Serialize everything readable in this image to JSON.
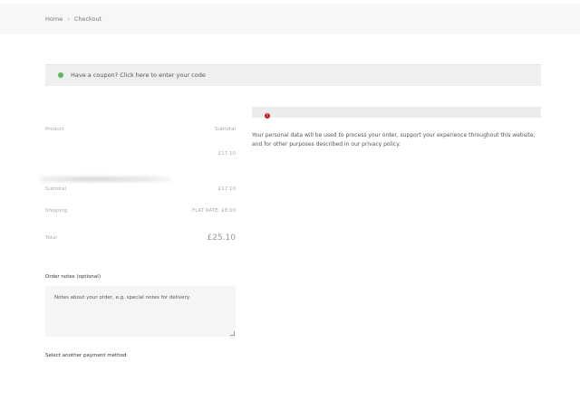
{
  "breadcrumb": {
    "home": "Home",
    "separator": "›",
    "current": "Checkout"
  },
  "coupon": {
    "text": "Have a coupon? Click here to enter your code"
  },
  "review": {
    "product_header": "Product",
    "subtotal_header": "Subtotal",
    "line_item_price": "£17.10",
    "subtotal_label": "Subtotal",
    "subtotal_value": "£17.10",
    "shipping_label": "Shipping",
    "shipping_value": "FLAT RATE: £8.00",
    "total_label": "Total",
    "total_value": "£25.10"
  },
  "notes": {
    "label": "Order notes (optional)",
    "placeholder": "Notes about your order, e.g. special notes for delivery."
  },
  "payment": {
    "error_icon": "!",
    "select_label": "Select another payment method",
    "privacy_text": "Your personal data will be used to process your order, support your experience throughout this website, and for other purposes described in our privacy policy."
  },
  "colors": {
    "coupon_icon": "#5cb85c",
    "error_icon": "#b81c23"
  },
  "icons": {
    "coupon": "info-icon",
    "error": "error-icon"
  }
}
